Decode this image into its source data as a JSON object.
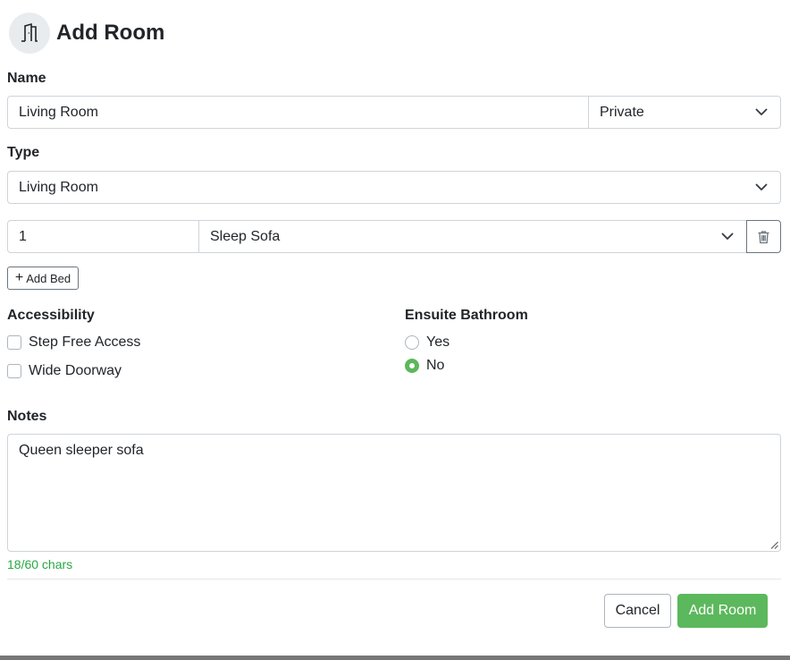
{
  "header": {
    "title": "Add Room",
    "icon": "door-icon"
  },
  "name_section": {
    "label": "Name",
    "value": "Living Room",
    "privacy_value": "Private"
  },
  "type_section": {
    "label": "Type",
    "value": "Living Room"
  },
  "beds": [
    {
      "quantity": "1",
      "type": "Sleep Sofa"
    }
  ],
  "add_bed": {
    "label": "Add Bed"
  },
  "accessibility": {
    "label": "Accessibility",
    "options": [
      {
        "label": "Step Free Access",
        "checked": false
      },
      {
        "label": "Wide Doorway",
        "checked": false
      }
    ]
  },
  "ensuite": {
    "label": "Ensuite Bathroom",
    "options": [
      {
        "label": "Yes",
        "selected": false
      },
      {
        "label": "No",
        "selected": true
      }
    ]
  },
  "notes": {
    "label": "Notes",
    "value": "Queen sleeper sofa",
    "count": "18/60 chars"
  },
  "footer": {
    "cancel": "Cancel",
    "submit": "Add Room"
  },
  "colors": {
    "accent": "#5cb85c",
    "count_text": "#28a745"
  }
}
